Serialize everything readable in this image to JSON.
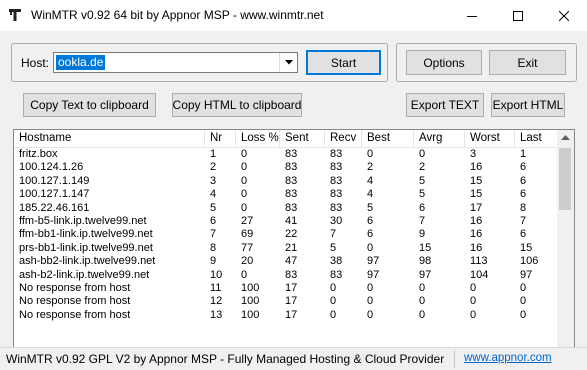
{
  "window": {
    "title": "WinMTR v0.92 64 bit by Appnor MSP - www.winmtr.net"
  },
  "host": {
    "label": "Host:",
    "value": "ookla.de"
  },
  "buttons": {
    "start": "Start",
    "options": "Options",
    "exit": "Exit",
    "copy_text": "Copy Text to clipboard",
    "copy_html": "Copy HTML to clipboard",
    "export_text": "Export TEXT",
    "export_html": "Export HTML"
  },
  "table": {
    "columns": [
      "Hostname",
      "Nr",
      "Loss %",
      "Sent",
      "Recv",
      "Best",
      "Avrg",
      "Worst",
      "Last"
    ],
    "rows": [
      [
        "fritz.box",
        "1",
        "0",
        "83",
        "83",
        "0",
        "0",
        "3",
        "1"
      ],
      [
        "100.124.1.26",
        "2",
        "0",
        "83",
        "83",
        "2",
        "2",
        "16",
        "6"
      ],
      [
        "100.127.1.149",
        "3",
        "0",
        "83",
        "83",
        "4",
        "5",
        "15",
        "6"
      ],
      [
        "100.127.1.147",
        "4",
        "0",
        "83",
        "83",
        "4",
        "5",
        "15",
        "6"
      ],
      [
        "185.22.46.161",
        "5",
        "0",
        "83",
        "83",
        "5",
        "6",
        "17",
        "8"
      ],
      [
        "ffm-b5-link.ip.twelve99.net",
        "6",
        "27",
        "41",
        "30",
        "6",
        "7",
        "16",
        "7"
      ],
      [
        "ffm-bb1-link.ip.twelve99.net",
        "7",
        "69",
        "22",
        "7",
        "6",
        "9",
        "16",
        "6"
      ],
      [
        "prs-bb1-link.ip.twelve99.net",
        "8",
        "77",
        "21",
        "5",
        "0",
        "15",
        "16",
        "15"
      ],
      [
        "ash-bb2-link.ip.twelve99.net",
        "9",
        "20",
        "47",
        "38",
        "97",
        "98",
        "113",
        "106"
      ],
      [
        "ash-b2-link.ip.twelve99.net",
        "10",
        "0",
        "83",
        "83",
        "97",
        "97",
        "104",
        "97"
      ],
      [
        "No response from host",
        "11",
        "100",
        "17",
        "0",
        "0",
        "0",
        "0",
        "0"
      ],
      [
        "No response from host",
        "12",
        "100",
        "17",
        "0",
        "0",
        "0",
        "0",
        "0"
      ],
      [
        "No response from host",
        "13",
        "100",
        "17",
        "0",
        "0",
        "0",
        "0",
        "0"
      ]
    ]
  },
  "status": {
    "text": "WinMTR v0.92 GPL V2 by Appnor MSP - Fully Managed Hosting & Cloud Provider",
    "link": "www.appnor.com"
  }
}
